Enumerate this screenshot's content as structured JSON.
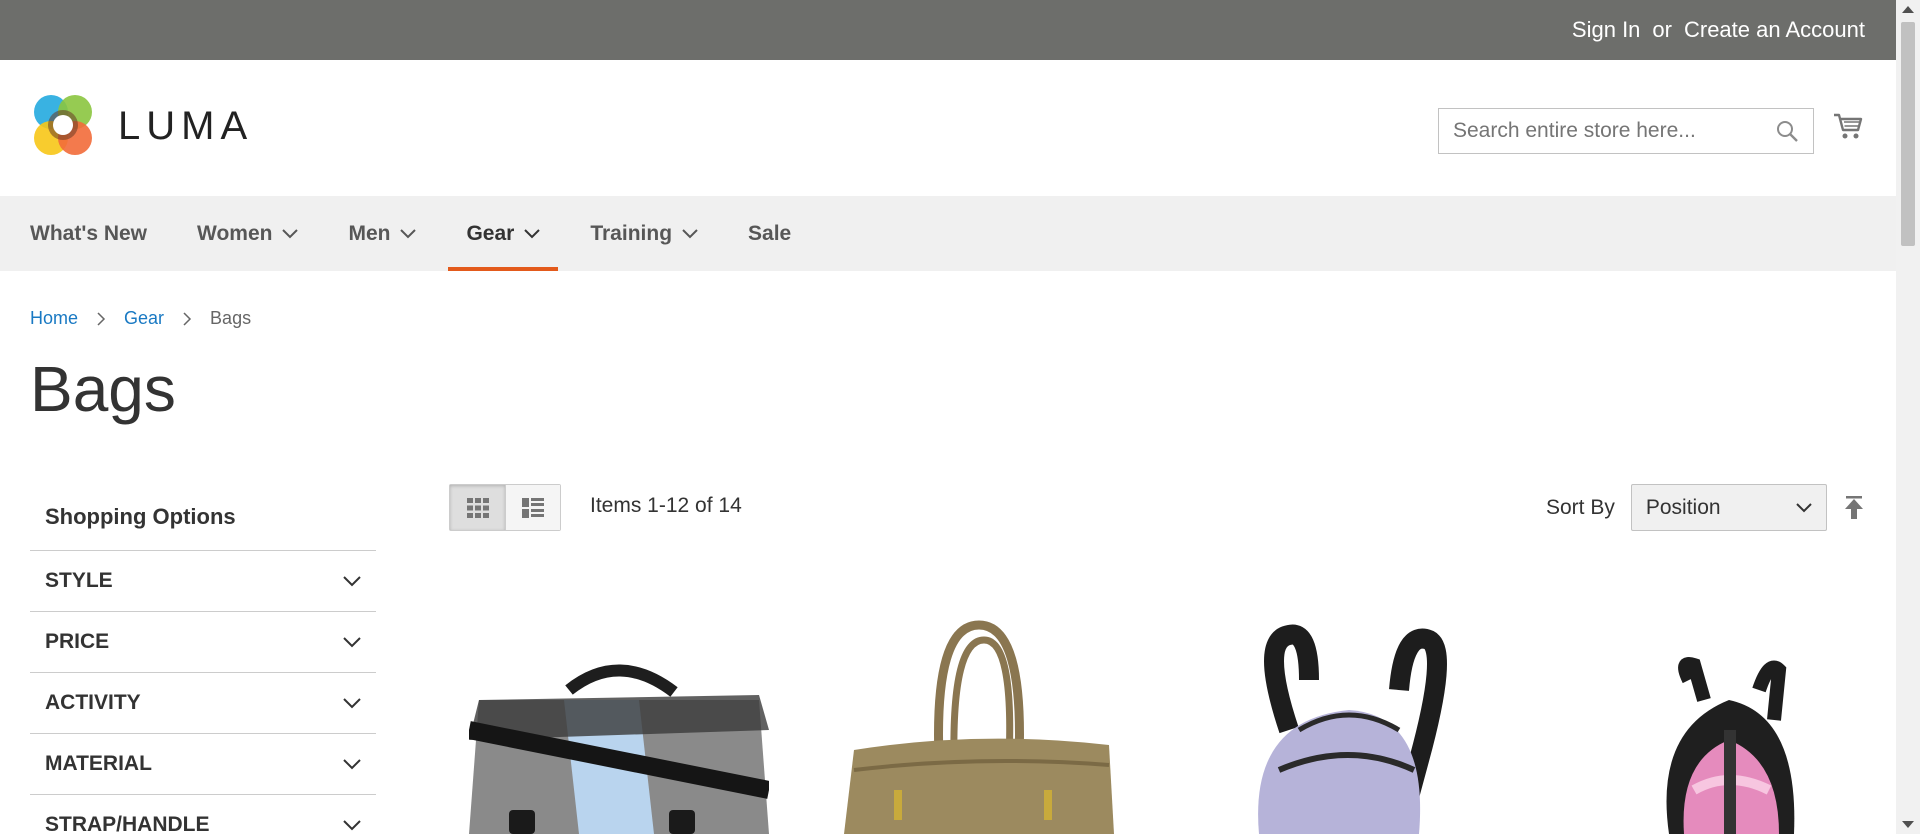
{
  "header": {
    "sign_in": "Sign In",
    "or": "or",
    "create_account": "Create an Account",
    "logo_text": "LUMA",
    "search_placeholder": "Search entire store here..."
  },
  "nav": {
    "items": [
      {
        "label": "What's New",
        "has_dropdown": false
      },
      {
        "label": "Women",
        "has_dropdown": true
      },
      {
        "label": "Men",
        "has_dropdown": true
      },
      {
        "label": "Gear",
        "has_dropdown": true,
        "active": true
      },
      {
        "label": "Training",
        "has_dropdown": true
      },
      {
        "label": "Sale",
        "has_dropdown": false
      }
    ],
    "active_color": "#e35a1b"
  },
  "breadcrumb": {
    "home": "Home",
    "gear": "Gear",
    "current": "Bags"
  },
  "page": {
    "title": "Bags"
  },
  "sidebar": {
    "heading": "Shopping Options",
    "filters": [
      "STYLE",
      "PRICE",
      "ACTIVITY",
      "MATERIAL",
      "STRAP/HANDLE"
    ]
  },
  "toolbar": {
    "amount": "Items 1-12 of 14",
    "sort_label": "Sort By",
    "sort_value": "Position"
  },
  "products": [
    {
      "icon": "messenger-bag-image"
    },
    {
      "icon": "tote-bag-image"
    },
    {
      "icon": "lavender-backpack-image"
    },
    {
      "icon": "pink-backpack-image"
    }
  ],
  "colors": {
    "topbar": "#6d6e6b",
    "link": "#1979c3",
    "nav_bg": "#f0f0f0"
  }
}
